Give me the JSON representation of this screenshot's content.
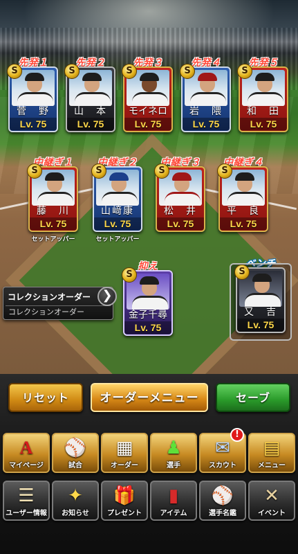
{
  "lineup": {
    "starters": [
      {
        "slot": "先発１",
        "name": "菅　野",
        "level": "Lv. 75",
        "badge": "S"
      },
      {
        "slot": "先発２",
        "name": "山　本",
        "level": "Lv. 75",
        "badge": "S"
      },
      {
        "slot": "先発３",
        "name": "モイネロ",
        "level": "Lv. 75",
        "badge": "S"
      },
      {
        "slot": "先発４",
        "name": "岩　隈",
        "level": "Lv. 75",
        "badge": "S"
      },
      {
        "slot": "先発５",
        "name": "和　田",
        "level": "Lv. 75",
        "badge": "S"
      }
    ],
    "relievers": [
      {
        "slot": "中継ぎ１",
        "name": "藤　川",
        "level": "Lv. 75",
        "badge": "S",
        "role": "セットアッパー"
      },
      {
        "slot": "中継ぎ２",
        "name": "山﨑康",
        "level": "Lv. 75",
        "badge": "S",
        "role": "セットアッパー"
      },
      {
        "slot": "中継ぎ３",
        "name": "松　井",
        "level": "Lv. 75",
        "badge": "S",
        "role": ""
      },
      {
        "slot": "中継ぎ４",
        "name": "平　良",
        "level": "Lv. 75",
        "badge": "S",
        "role": ""
      }
    ],
    "closer": {
      "slot": "抑え",
      "name": "金子千尋",
      "level": "Lv. 75",
      "badge": "S"
    },
    "bench": {
      "slot": "ベンチ",
      "name": "又　吉",
      "level": "Lv. 75",
      "badge": "S"
    }
  },
  "collection_order": {
    "title": "コレクションオーダー",
    "value": "コレクションオーダー",
    "arrow": "❯"
  },
  "actions": {
    "reset": "リセット",
    "order_menu": "オーダーメニュー",
    "save": "セーブ"
  },
  "menu_top": [
    {
      "label": "マイページ",
      "icon": "A"
    },
    {
      "label": "試合",
      "icon": "⚾"
    },
    {
      "label": "オーダー",
      "icon": "▦"
    },
    {
      "label": "選手",
      "icon": "♟"
    },
    {
      "label": "スカウト",
      "icon": "✉"
    },
    {
      "label": "メニュー",
      "icon": "▤"
    }
  ],
  "menu_bottom": [
    {
      "label": "ユーザー情報",
      "icon": "☰"
    },
    {
      "label": "お知らせ",
      "icon": "✦"
    },
    {
      "label": "プレゼント",
      "icon": "🎁"
    },
    {
      "label": "アイテム",
      "icon": "▮"
    },
    {
      "label": "選手名鑑",
      "icon": "⚾"
    },
    {
      "label": "イベント",
      "icon": "✕"
    }
  ],
  "scout_alert": "!",
  "colors": {
    "slot_label": "#ff4a3a",
    "level_text": "#ffd84a",
    "reset_button": "#d08a14",
    "save_button": "#2a9a2a"
  }
}
